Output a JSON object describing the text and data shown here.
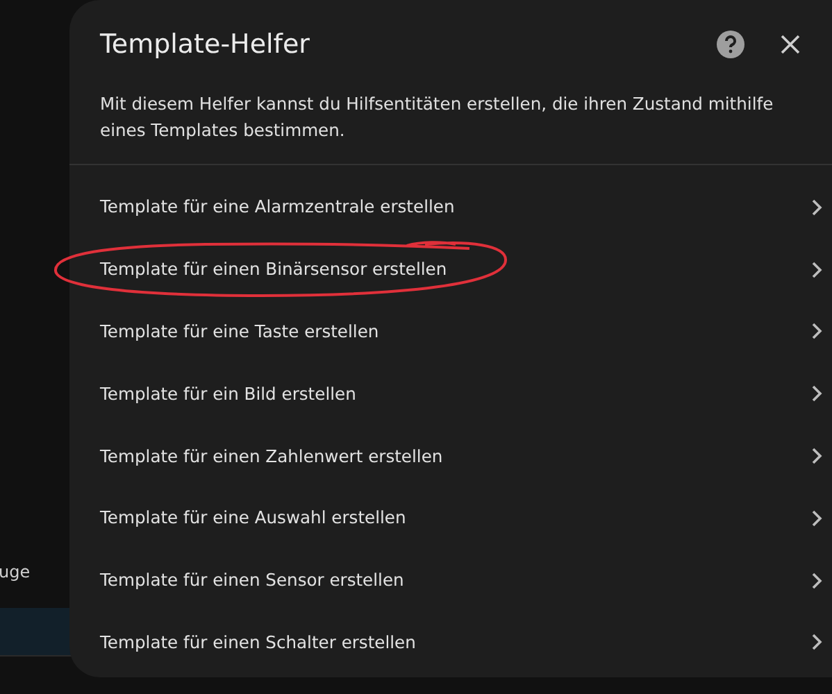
{
  "background": {
    "sidebar_text": "uge"
  },
  "dialog": {
    "title": "Template-Helfer",
    "description": "Mit diesem Helfer kannst du Hilfsentitäten erstellen, die ihren Zustand mithilfe eines Templates bestimmen.",
    "items": [
      {
        "label": "Template für eine Alarmzentrale erstellen",
        "circled": false
      },
      {
        "label": "Template für einen Binärsensor erstellen",
        "circled": true
      },
      {
        "label": "Template für eine Taste erstellen",
        "circled": false
      },
      {
        "label": "Template für ein Bild erstellen",
        "circled": false
      },
      {
        "label": "Template für einen Zahlenwert erstellen",
        "circled": false
      },
      {
        "label": "Template für eine Auswahl erstellen",
        "circled": false
      },
      {
        "label": "Template für einen Sensor erstellen",
        "circled": false
      },
      {
        "label": "Template für einen Schalter erstellen",
        "circled": false
      }
    ]
  }
}
